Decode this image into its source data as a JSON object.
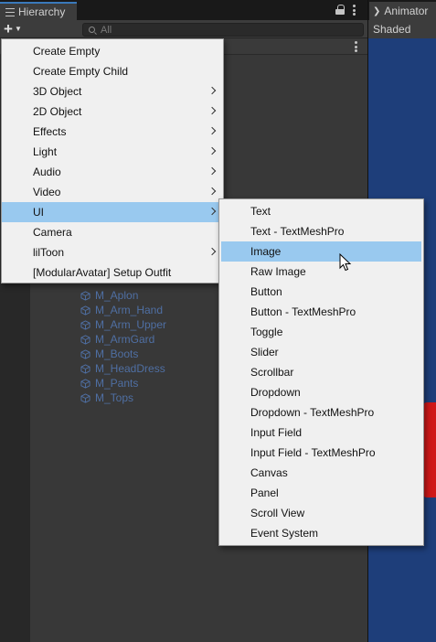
{
  "hierarchy": {
    "tab_title": "Hierarchy",
    "add_button": "+",
    "search_placeholder": "All"
  },
  "right_panel": {
    "tab_title": "Animator",
    "shading_mode": "Shaded"
  },
  "objects": [
    "M_Aplon",
    "M_Arm_Hand",
    "M_Arm_Upper",
    "M_ArmGard",
    "M_Boots",
    "M_HeadDress",
    "M_Pants",
    "M_Tops"
  ],
  "main_menu": [
    {
      "label": "Create Empty",
      "submenu": false
    },
    {
      "label": "Create Empty Child",
      "submenu": false
    },
    {
      "label": "3D Object",
      "submenu": true
    },
    {
      "label": "2D Object",
      "submenu": true
    },
    {
      "label": "Effects",
      "submenu": true
    },
    {
      "label": "Light",
      "submenu": true
    },
    {
      "label": "Audio",
      "submenu": true
    },
    {
      "label": "Video",
      "submenu": true
    },
    {
      "label": "UI",
      "submenu": true,
      "highlighted": true
    },
    {
      "label": "Camera",
      "submenu": false
    },
    {
      "label": "lilToon",
      "submenu": true
    },
    {
      "label": "[ModularAvatar] Setup Outfit",
      "submenu": false
    }
  ],
  "ui_submenu": [
    {
      "label": "Text"
    },
    {
      "label": "Text - TextMeshPro"
    },
    {
      "label": "Image",
      "highlighted": true
    },
    {
      "label": "Raw Image"
    },
    {
      "label": "Button"
    },
    {
      "label": "Button - TextMeshPro"
    },
    {
      "label": "Toggle"
    },
    {
      "label": "Slider"
    },
    {
      "label": "Scrollbar"
    },
    {
      "label": "Dropdown"
    },
    {
      "label": "Dropdown - TextMeshPro"
    },
    {
      "label": "Input Field"
    },
    {
      "label": "Input Field - TextMeshPro"
    },
    {
      "label": "Canvas"
    },
    {
      "label": "Panel"
    },
    {
      "label": "Scroll View"
    },
    {
      "label": "Event System"
    }
  ],
  "colors": {
    "highlight": "#99c9ef",
    "tab_accent": "#3a79bb",
    "object_text": "#4f6fa3",
    "scene_view": "#1e3e7a"
  }
}
